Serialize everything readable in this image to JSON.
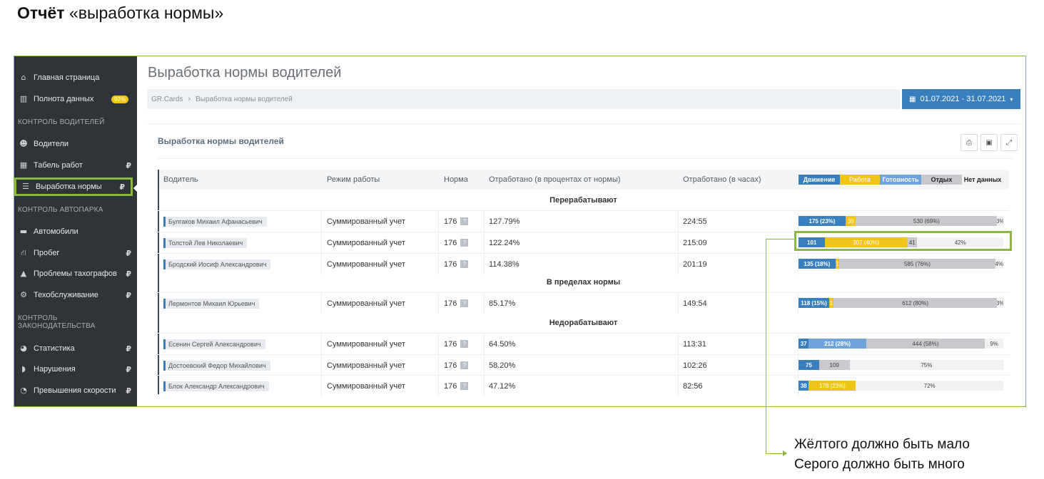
{
  "slide": {
    "title_bold": "Отчёт",
    "title_rest": " «выработка нормы»",
    "notes": [
      "Жёлтого должно быть мало",
      "Серого должно быть много"
    ]
  },
  "sidebar": {
    "items": [
      {
        "label": "Главная страница",
        "icon": "home-icon"
      },
      {
        "label": "Полнота данных",
        "icon": "bar-chart-icon",
        "badge": "92%"
      },
      {
        "label": "Водители",
        "icon": "users-icon"
      },
      {
        "label": "Табель работ",
        "icon": "table-icon",
        "ruble": "₽"
      },
      {
        "label": "Выработка нормы",
        "icon": "list-icon",
        "ruble": "₽"
      },
      {
        "label": "Автомобили",
        "icon": "truck-icon"
      },
      {
        "label": "Пробег",
        "icon": "road-icon",
        "ruble": "₽"
      },
      {
        "label": "Проблемы тахографов",
        "icon": "warning-icon",
        "ruble": "₽"
      },
      {
        "label": "Техобслуживание",
        "icon": "gears-icon",
        "ruble": "₽"
      },
      {
        "label": "Статистика",
        "icon": "pie-chart-icon",
        "ruble": "₽"
      },
      {
        "label": "Нарушения",
        "icon": "shield-icon",
        "ruble": "₽"
      },
      {
        "label": "Превышения скорости",
        "icon": "tachometer-icon",
        "ruble": "₽"
      }
    ],
    "sections": [
      "КОНТРОЛЬ ВОДИТЕЛЕЙ",
      "КОНТРОЛЬ АВТОПАРКА",
      "КОНТРОЛЬ",
      "ЗАКОНОДАТЕЛЬСТВА"
    ]
  },
  "header": {
    "title": "Выработка нормы водителей",
    "breadcrumb": [
      "GR.Cards",
      "Выработка нормы водителей"
    ],
    "date_range": "01.07.2021 - 31.07.2021"
  },
  "panel": {
    "title": "Выработка нормы водителей",
    "tools": [
      "print-icon",
      "export-icon",
      "fullscreen-icon"
    ]
  },
  "table": {
    "columns": [
      "Водитель",
      "Режим работы",
      "Норма",
      "Отработано (в процентах от нормы)",
      "Отработано (в часах)"
    ],
    "legend": [
      "Движение",
      "Работа",
      "Готовность",
      "Отдых",
      "Нет данных"
    ],
    "groups": [
      "Перерабатывают",
      "В пределах нормы",
      "Недорабатывают"
    ],
    "rows": [
      {
        "driver": "Булгаков Михаил Афанасьевич",
        "mode": "Суммированный учет",
        "norm": "176",
        "pct": "127.79%",
        "hours": "224:55",
        "segs": [
          {
            "c": "drive",
            "w": 23,
            "t": "175 (23%)"
          },
          {
            "c": "work",
            "w": 5,
            "t": "39"
          },
          {
            "c": "rest",
            "w": 69,
            "t": "530 (69%)"
          },
          {
            "c": "none",
            "w": 3,
            "t": "3%"
          }
        ]
      },
      {
        "driver": "Толстой Лев Николаевич",
        "mode": "Суммированный учет",
        "norm": "176",
        "pct": "122.24%",
        "hours": "215:09",
        "segs": [
          {
            "c": "drive",
            "w": 13,
            "t": "101"
          },
          {
            "c": "work",
            "w": 40,
            "t": "307 (40%)"
          },
          {
            "c": "rest",
            "w": 5,
            "t": "41"
          },
          {
            "c": "none",
            "w": 42,
            "t": "42%"
          }
        ]
      },
      {
        "driver": "Бродский Иосиф Александрович",
        "mode": "Суммированный учет",
        "norm": "176",
        "pct": "114.38%",
        "hours": "201:19",
        "segs": [
          {
            "c": "drive",
            "w": 18,
            "t": "135 (18%)"
          },
          {
            "c": "work",
            "w": 2,
            "t": "1"
          },
          {
            "c": "rest",
            "w": 76,
            "t": "585 (76%)"
          },
          {
            "c": "none",
            "w": 4,
            "t": "4%"
          }
        ]
      },
      {
        "driver": "Лермонтов Михаил Юрьевич",
        "mode": "Суммированный учет",
        "norm": "176",
        "pct": "85.17%",
        "hours": "149:54",
        "segs": [
          {
            "c": "drive",
            "w": 15,
            "t": "118 (15%)"
          },
          {
            "c": "work",
            "w": 2,
            "t": "1"
          },
          {
            "c": "rest",
            "w": 80,
            "t": "612 (80%)"
          },
          {
            "c": "none",
            "w": 3,
            "t": "3%"
          }
        ]
      },
      {
        "driver": "Есенин Сергей Александрович",
        "mode": "Суммированный учет",
        "norm": "176",
        "pct": "64.50%",
        "hours": "113:31",
        "segs": [
          {
            "c": "drive",
            "w": 5,
            "t": "37"
          },
          {
            "c": "ready",
            "w": 28,
            "t": "212 (28%)"
          },
          {
            "c": "rest",
            "w": 58,
            "t": "444 (58%)"
          },
          {
            "c": "none",
            "w": 9,
            "t": "9%"
          }
        ]
      },
      {
        "driver": "Достоевский Федор Михайлович",
        "mode": "Суммированный учет",
        "norm": "176",
        "pct": "58.20%",
        "hours": "102:26",
        "segs": [
          {
            "c": "drive",
            "w": 10,
            "t": "75"
          },
          {
            "c": "rest",
            "w": 15,
            "t": "109"
          },
          {
            "c": "none",
            "w": 75,
            "t": "75%"
          }
        ]
      },
      {
        "driver": "Блок Александр Александрович",
        "mode": "Суммированный учет",
        "norm": "176",
        "pct": "47.12%",
        "hours": "82:56",
        "segs": [
          {
            "c": "drive",
            "w": 5,
            "t": "38"
          },
          {
            "c": "work",
            "w": 23,
            "t": "178 (23%)"
          },
          {
            "c": "none",
            "w": 72,
            "t": "72%"
          }
        ]
      }
    ]
  }
}
